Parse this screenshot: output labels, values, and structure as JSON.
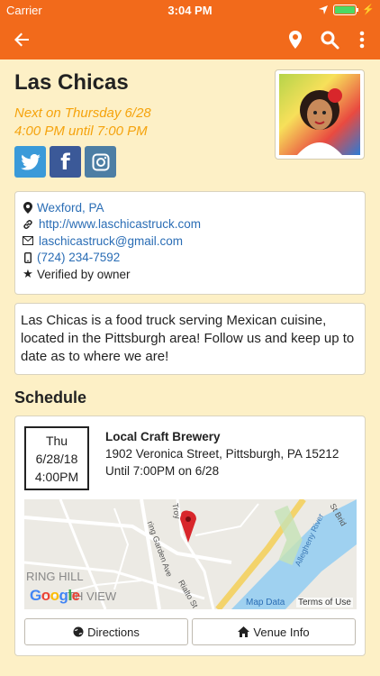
{
  "status_bar": {
    "carrier": "Carrier",
    "time": "3:04 PM"
  },
  "nav": {
    "icons": [
      "back-arrow-icon",
      "map-pin-icon",
      "search-icon",
      "more-vertical-icon"
    ],
    "color": "#f26a1b"
  },
  "truck": {
    "name": "Las Chicas",
    "next_line1": "Next on Thursday 6/28",
    "next_line2": "4:00 PM until 7:00 PM",
    "location": "Wexford, PA",
    "website": "http://www.laschicastruck.com",
    "email": "laschicastruck@gmail.com",
    "phone": "(724) 234-7592",
    "verified": "Verified by owner",
    "description": "Las Chicas is a food truck serving Mexican cuisine, located in the Pittsburgh area! Follow us and keep up to date as to where we are!"
  },
  "socials": [
    {
      "name": "twitter",
      "glyph": "t"
    },
    {
      "name": "facebook",
      "glyph": "f"
    },
    {
      "name": "instagram",
      "glyph": "◎"
    }
  ],
  "schedule": {
    "heading": "Schedule",
    "day": "Thu",
    "date": "6/28/18",
    "time": "4:00PM",
    "venue": "Local Craft Brewery",
    "address": "1902 Veronica Street, Pittsburgh, PA 15212",
    "until": "Until 7:00PM on 6/28",
    "map": {
      "google": "Google",
      "map_data": "Map Data",
      "terms": "Terms of Use",
      "labels": {
        "river": "Allegheny River",
        "ave": "ring Garden Ave",
        "st": "Rialto St",
        "hill": "RING HILL",
        "view": "TH VIEW",
        "troy": "Troy",
        "brid": "St Brid"
      }
    },
    "directions": "Directions",
    "venue_info": "Venue Info"
  },
  "colors": {
    "accent": "#f26a1b",
    "background": "#fdf0c6",
    "italic_time": "#f5a30d",
    "link": "#2a6db5"
  }
}
